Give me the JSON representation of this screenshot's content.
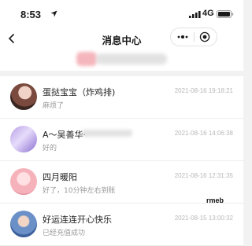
{
  "status_bar": {
    "time": "8:53",
    "network": "4G",
    "icons": [
      "location-arrow-icon",
      "signal-icon",
      "battery-icon"
    ]
  },
  "nav": {
    "title": "消息中心",
    "back_icon": "chevron-left-icon",
    "capsule_icons": [
      "more-dots-icon",
      "close-miniprogram-icon"
    ]
  },
  "messages": [
    {
      "name": "蛋挞宝宝（炸鸡排)",
      "preview": "麻烦了",
      "time": "2021-08-16 19:18:21",
      "avatar": "avatar-photo"
    },
    {
      "name": "A～吴善华·",
      "preview": "好的",
      "time": "2021-08-16 14:06:38",
      "avatar": "avatar-photo"
    },
    {
      "name": "四月暖阳",
      "preview": "好了，10分钟左右到账",
      "time": "2021-08-16 12:31:35",
      "avatar": "avatar-photo"
    },
    {
      "name": "好运连连开心快乐",
      "preview": "已经充值成功",
      "time": "2021-08-15 13:00:32",
      "avatar": "avatar-photo"
    }
  ],
  "watermark": "rmeb",
  "colors": {
    "background": "#f2f2f2",
    "card": "#ffffff",
    "muted_text": "#9a9a9a",
    "time_text": "#b8b8b8"
  }
}
